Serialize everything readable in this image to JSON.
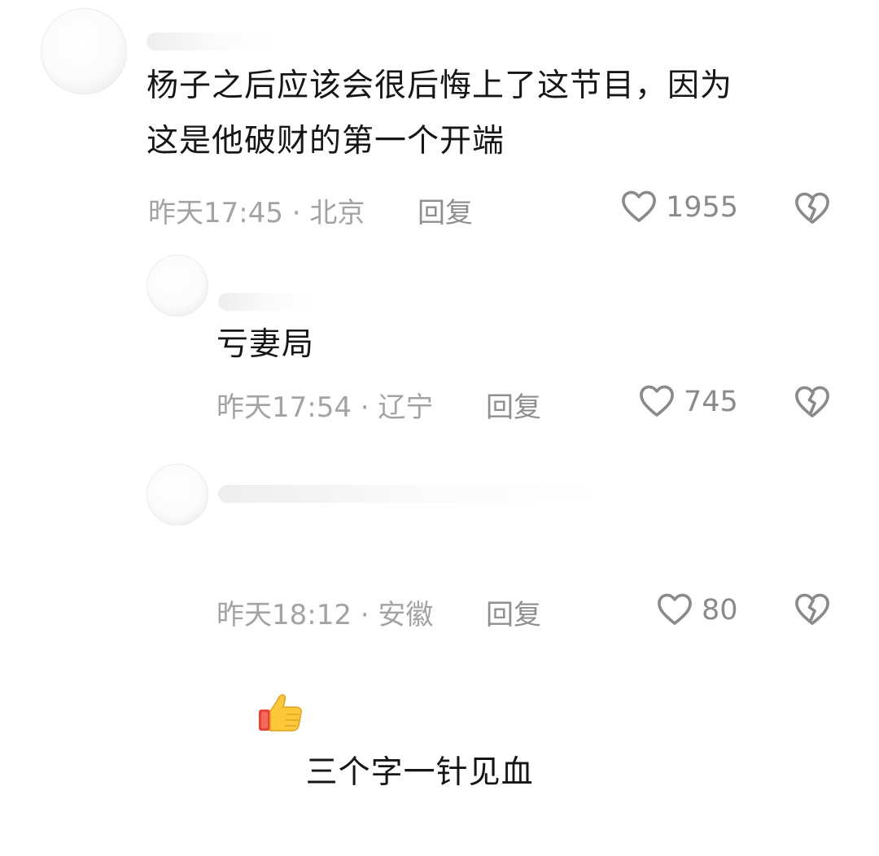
{
  "comments": [
    {
      "text": "杨子之后应该会很后悔上了这节目，因为\n这是他破财的第一个开端",
      "meta": "昨天17:45 · 北京",
      "reply_label": "回复",
      "like_count": "1955",
      "like_icon": "heart-outline-icon",
      "dislike_icon": "broken-heart-icon"
    },
    {
      "text": "亏妻局",
      "meta": "昨天17:54 · 辽宁",
      "reply_label": "回复",
      "like_count": "745",
      "like_icon": "heart-outline-icon",
      "dislike_icon": "broken-heart-icon"
    },
    {
      "emoji": "thumbs-up-emoji",
      "text": "三个字一针见血",
      "meta": "昨天18:12 · 安徽",
      "reply_label": "回复",
      "like_count": "80",
      "like_icon": "heart-outline-icon",
      "dislike_icon": "broken-heart-icon"
    }
  ],
  "colors": {
    "text": "#161616",
    "meta": "#a3a3a3",
    "icon": "#8a8a8a"
  }
}
